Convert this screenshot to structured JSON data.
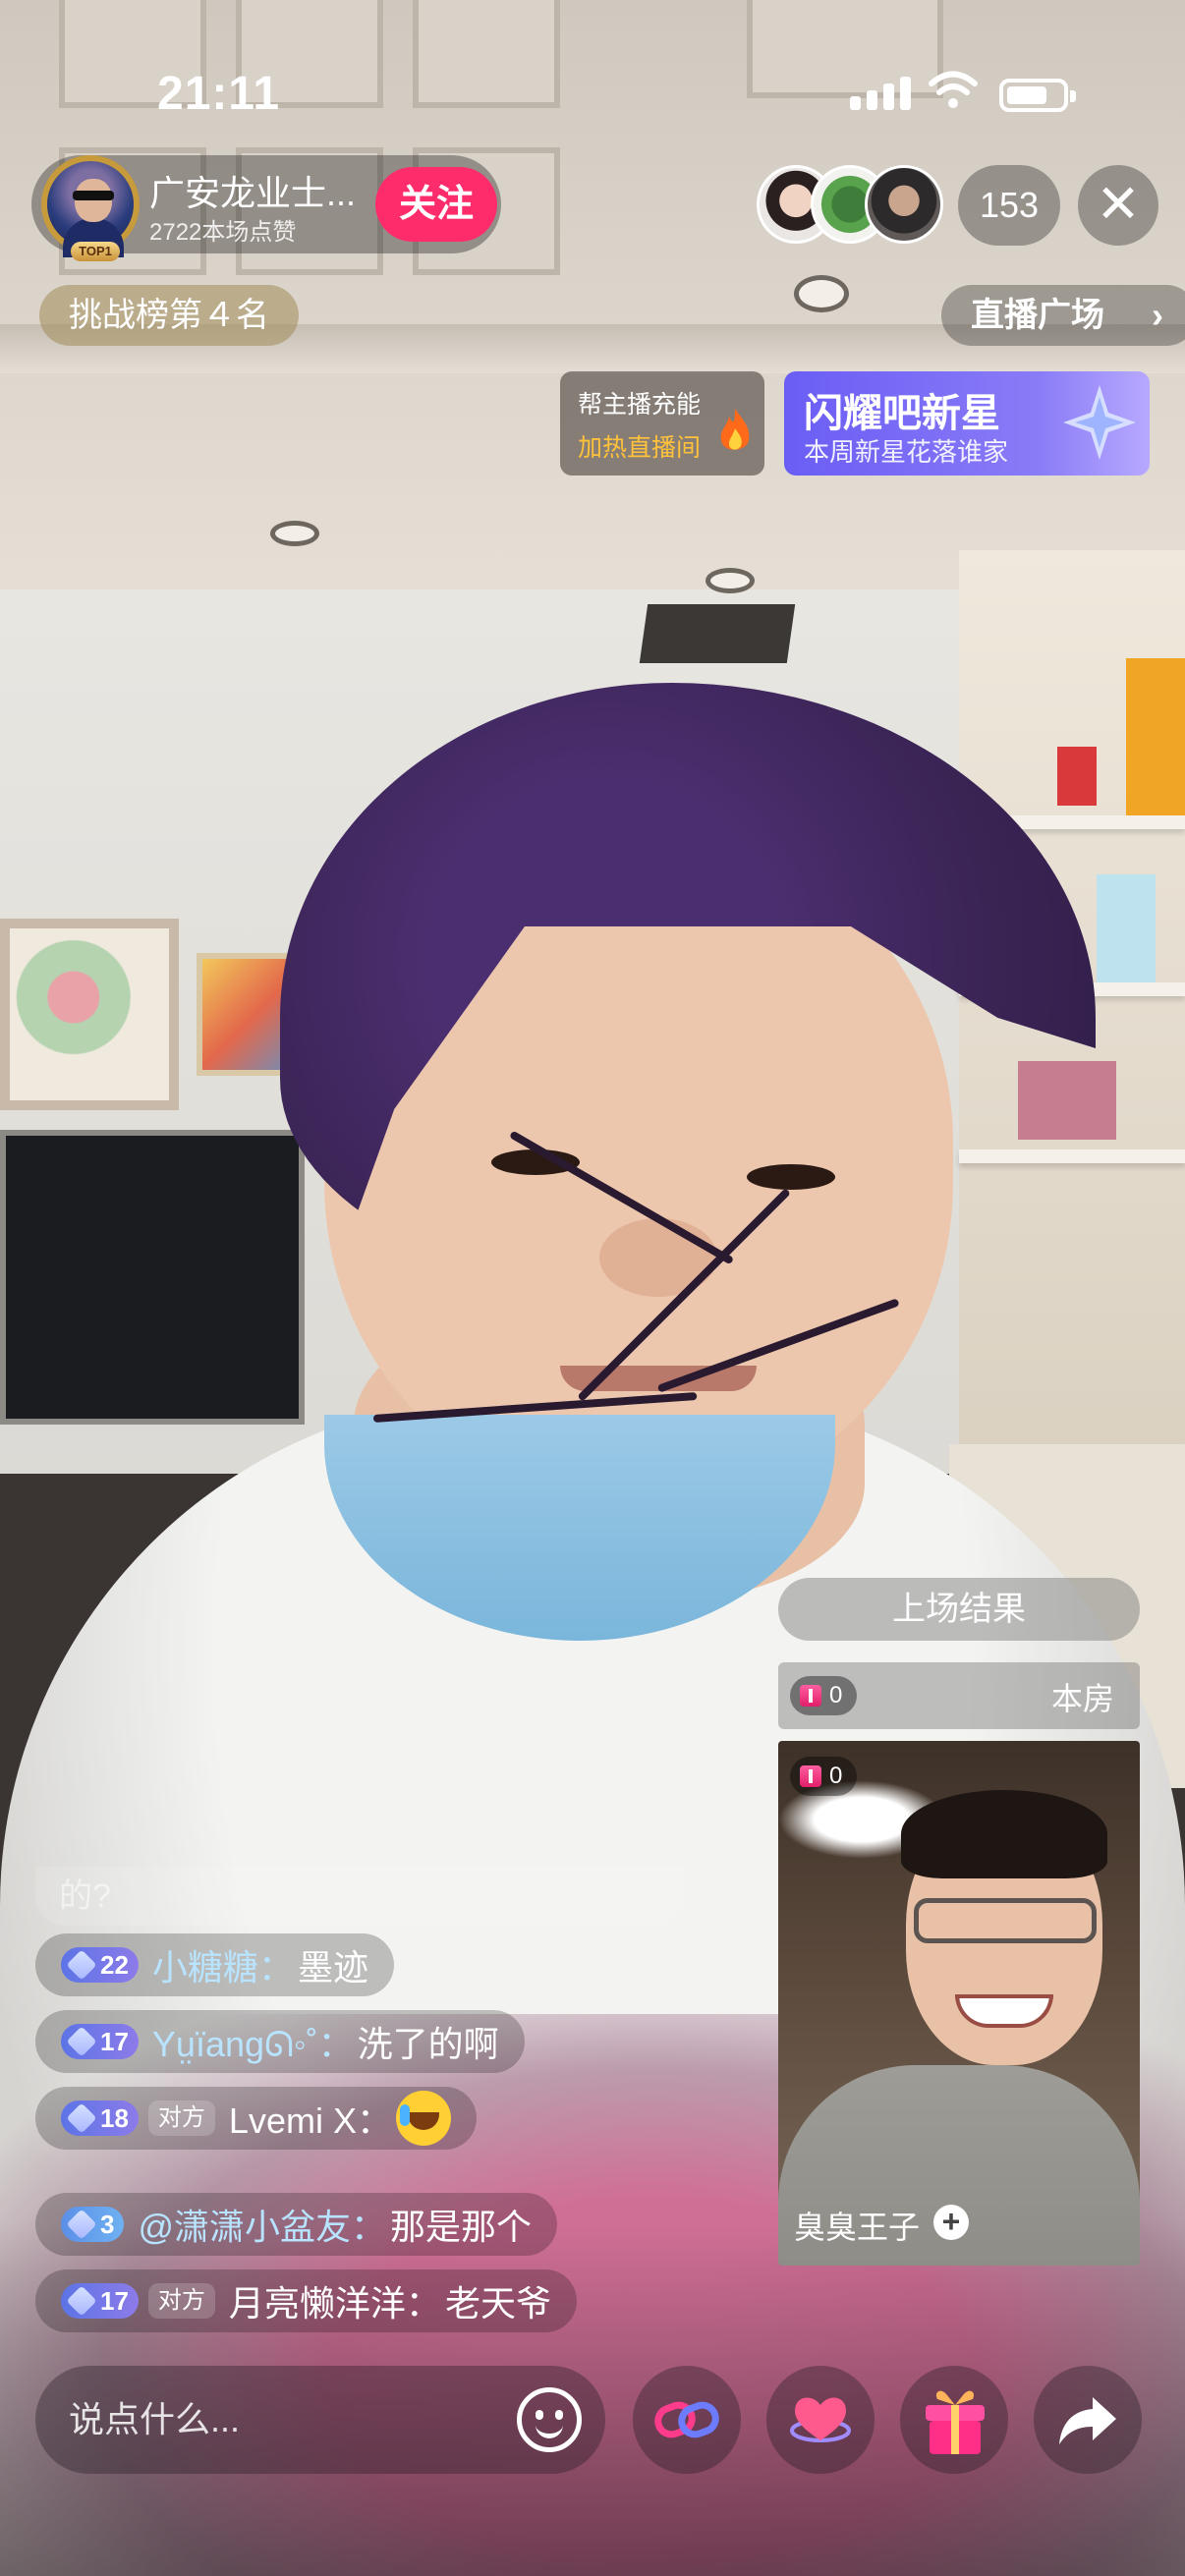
{
  "status_bar": {
    "time": "21:11"
  },
  "host": {
    "name": "广安龙业士...",
    "likes": "2722本场点赞",
    "badge": "TOP1",
    "follow_label": "关注"
  },
  "rank_label": "挑战榜第４名",
  "viewer_count": "153",
  "close_icon": "close-icon",
  "plaza": {
    "label": "直播广场",
    "chevron": "›"
  },
  "boost_card": {
    "line1": "帮主播充能",
    "line2": "加热直播间"
  },
  "star_card": {
    "title": "闪耀吧新星",
    "subtitle": "本周新星花落谁家"
  },
  "pk": {
    "result_label": "上场结果",
    "home_score": "0",
    "home_label": "本房",
    "opponent_score": "0",
    "opponent_name": "臭臭王子",
    "opponent_plus": "+"
  },
  "comments": {
    "faded": "的?",
    "items": [
      {
        "level": "22",
        "tag": "",
        "user": "小糖糖：",
        "text": "墨迹"
      },
      {
        "level": "17",
        "tag": "",
        "user": "Yṳïangᘏ◦˚：",
        "text": "洗了的啊"
      },
      {
        "level": "18",
        "tag": "对方",
        "user": "Lvemi X：",
        "text": ""
      },
      {
        "level": "3",
        "tag": "",
        "user": "@潇潇小盆友：",
        "text": "那是那个"
      },
      {
        "level": "17",
        "tag": "对方",
        "user": "月亮懒洋洋：",
        "text": "老天爷"
      }
    ]
  },
  "input": {
    "placeholder": "说点什么..."
  },
  "colors": {
    "follow": "#fe2c6a",
    "accent_gold": "#ffc23a",
    "star_card": "#6a5df5"
  }
}
